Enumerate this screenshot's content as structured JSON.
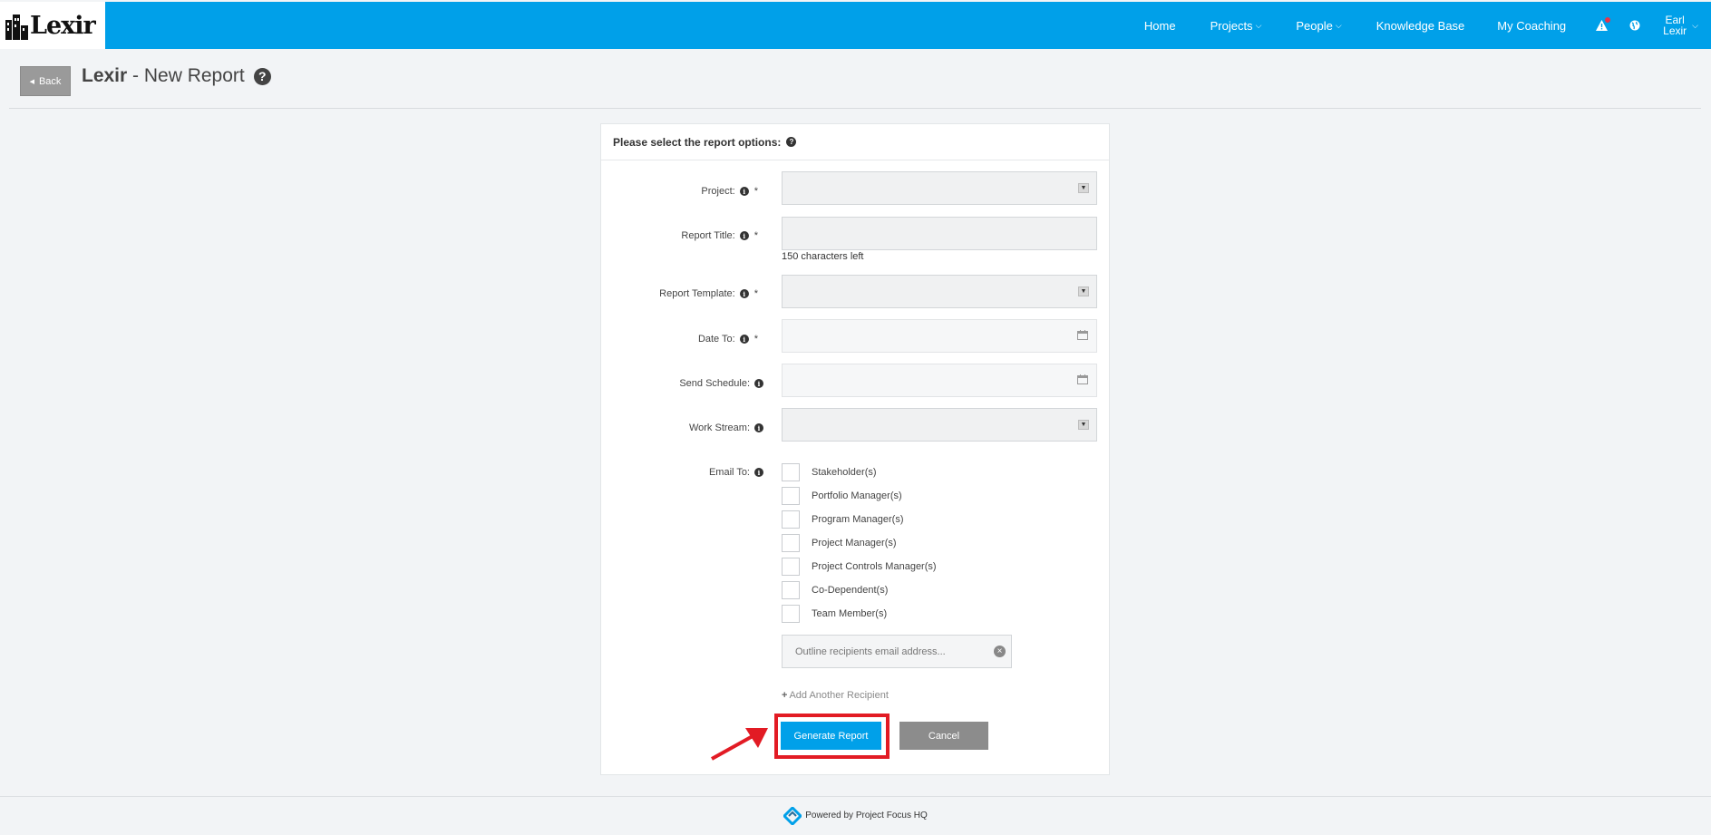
{
  "app": {
    "brand": "Lexir"
  },
  "nav": {
    "home": "Home",
    "projects": "Projects",
    "people": "People",
    "knowledge_base": "Knowledge Base",
    "my_coaching": "My Coaching",
    "user_first": "Earl",
    "user_last": "Lexir"
  },
  "header": {
    "back": "Back",
    "brand": "Lexir",
    "title_suffix": " - New Report"
  },
  "form": {
    "heading": "Please select the report options:",
    "project_label": "Project:",
    "report_title_label": "Report Title:",
    "chars_left": "150 characters left",
    "template_label": "Report Template:",
    "date_to_label": "Date To:",
    "send_schedule_label": "Send Schedule:",
    "work_stream_label": "Work Stream:",
    "email_to_label": "Email To:",
    "required_mark": "*",
    "recipients": [
      "Stakeholder(s)",
      "Portfolio Manager(s)",
      "Program Manager(s)",
      "Project Manager(s)",
      "Project Controls Manager(s)",
      "Co-Dependent(s)",
      "Team Member(s)"
    ],
    "email_placeholder": "Outline recipients email address...",
    "add_recipient": "Add Another Recipient",
    "generate": "Generate Report",
    "cancel": "Cancel"
  },
  "footer": {
    "powered_by": "Powered by Project Focus HQ"
  },
  "colors": {
    "accent": "#00a0e9",
    "highlight": "#e21b24",
    "cancel": "#8c8c8c"
  }
}
